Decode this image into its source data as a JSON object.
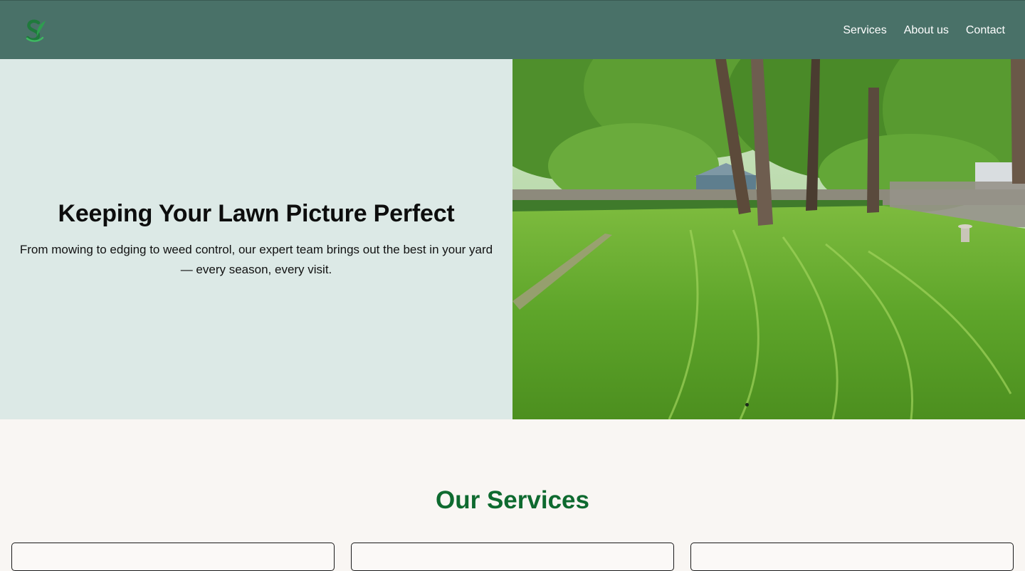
{
  "nav": {
    "logo_icon": "leaf-s-logo-icon",
    "links": [
      "Services",
      "About us",
      "Contact"
    ]
  },
  "hero": {
    "title": "Keeping Your Lawn Picture Perfect",
    "subtitle": "From mowing to edging to weed control, our expert team brings out the best in your yard — every season, every visit.",
    "image": "mowed-backyard-lawn-with-trees"
  },
  "services": {
    "title": "Our Services"
  },
  "colors": {
    "nav_bg": "#497168",
    "hero_left_bg": "#dce9e6",
    "accent_green": "#0e6a2f",
    "page_bg": "#f9f6f3"
  }
}
